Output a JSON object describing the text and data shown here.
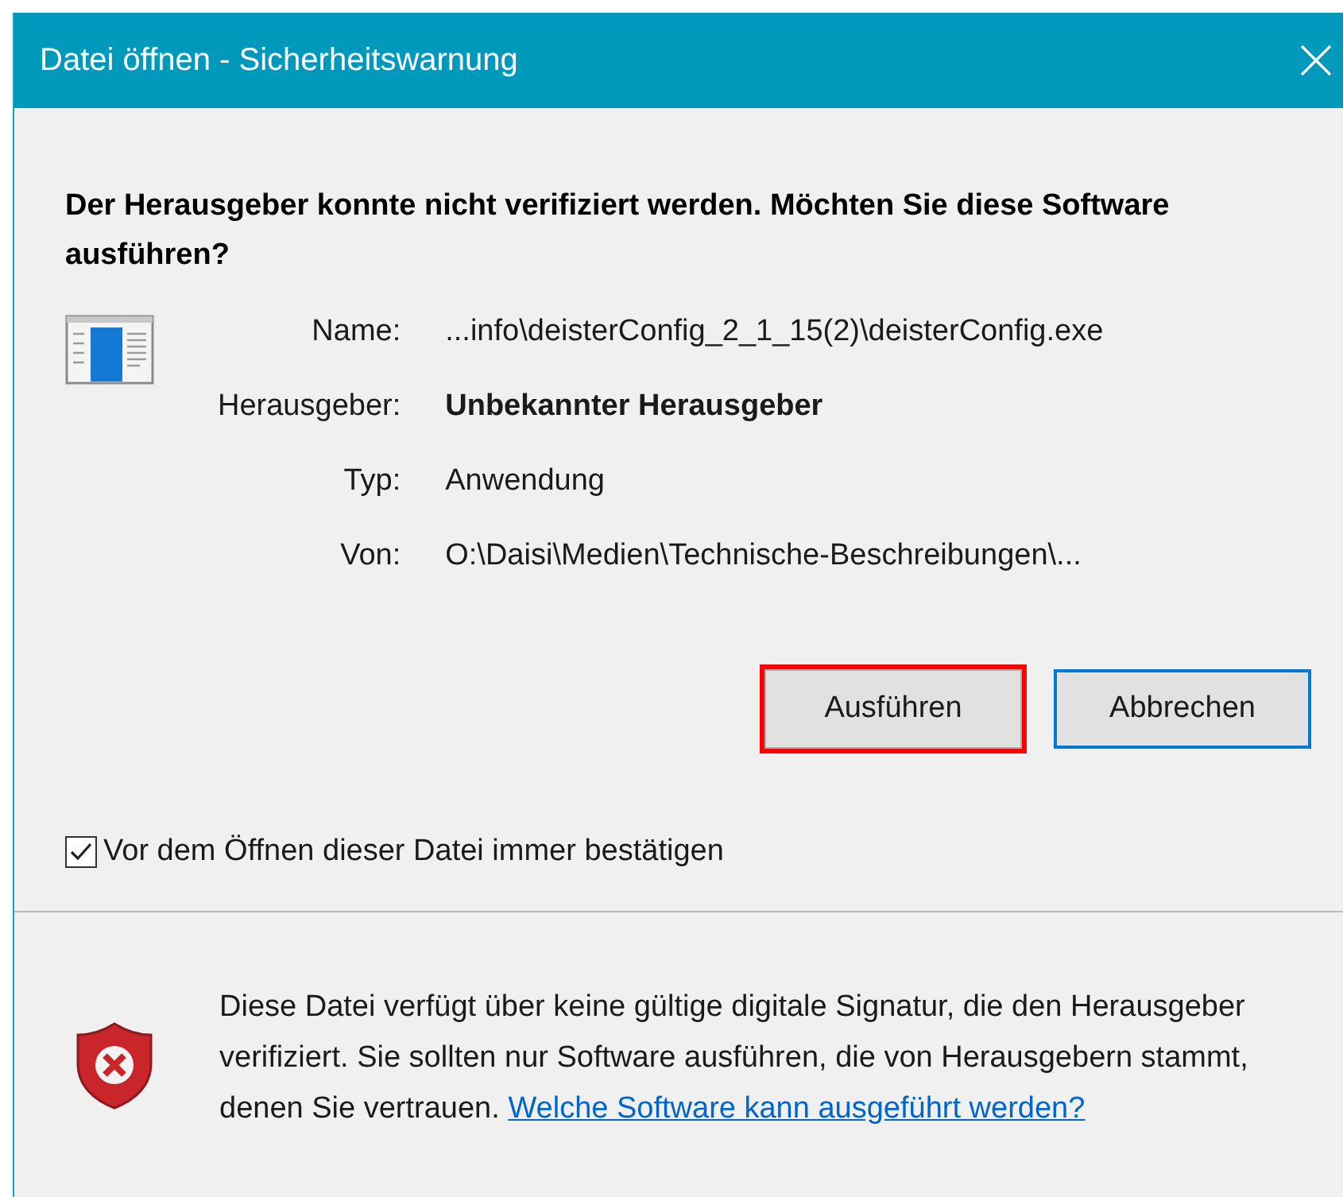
{
  "window": {
    "title": "Datei öffnen - Sicherheitswarnung"
  },
  "heading": "Der Herausgeber konnte nicht verifiziert werden. Möchten Sie diese Software ausführen?",
  "details": [
    {
      "label": "Name:",
      "value": "...info\\deisterConfig_2_1_15(2)\\deisterConfig.exe",
      "emphasis": false
    },
    {
      "label": "Herausgeber:",
      "value": "Unbekannter Herausgeber",
      "emphasis": true
    },
    {
      "label": "Typ:",
      "value": "Anwendung",
      "emphasis": false
    },
    {
      "label": "Von:",
      "value": "O:\\Daisi\\Medien\\Technische-Beschreibungen\\...",
      "emphasis": false
    }
  ],
  "buttons": [
    {
      "label": "Ausführen",
      "focused": false,
      "highlighted": true
    },
    {
      "label": "Abbrechen",
      "focused": true,
      "highlighted": false
    }
  ],
  "checkbox": {
    "label": "Vor dem Öffnen dieser Datei immer bestätigen",
    "checked": true
  },
  "warning": {
    "text": "Diese Datei verfügt über keine gültige digitale Signatur, die den Herausgeber verifiziert. Sie sollten nur Software ausführen, die von Herausgebern stammt, denen Sie vertrauen.",
    "link": "Welche Software kann ausgeführt werden?"
  }
}
